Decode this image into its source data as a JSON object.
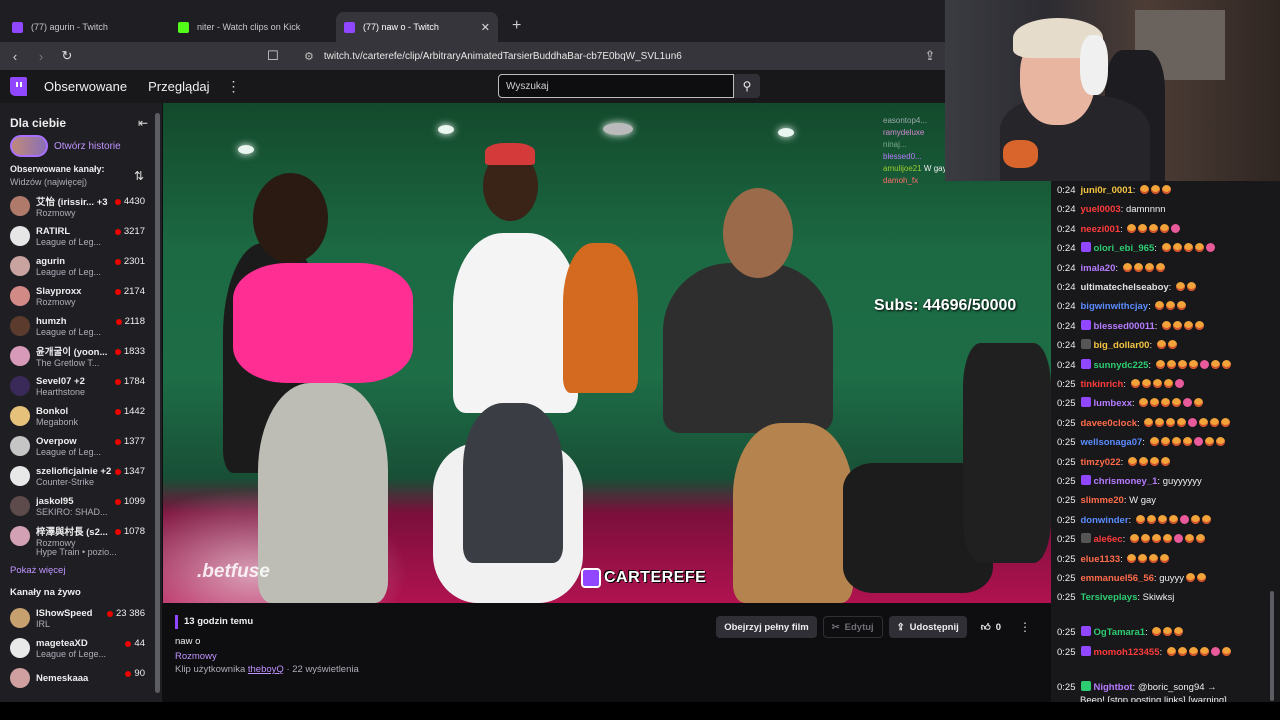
{
  "browser": {
    "tabs": [
      {
        "title": "(77) agurin - Twitch",
        "icon": "twitch-icon",
        "active": false
      },
      {
        "title": "niter - Watch clips on Kick",
        "icon": "kick-icon",
        "active": false
      },
      {
        "title": "(77) naw o - Twitch",
        "icon": "twitch-icon",
        "active": true
      }
    ],
    "url": "twitch.tv/carterefe/clip/ArbitraryAnimatedTarsierBuddhaBar-cb7E0bqW_SVL1un6"
  },
  "topnav": {
    "following": "Obserwowane",
    "browse": "Przeglądaj",
    "search_placeholder": "Wyszukaj"
  },
  "sidebar": {
    "title": "Dla ciebie",
    "stories_label": "Otwórz historie",
    "followed_title": "Obserwowane kanały:",
    "followed_sort": "Widzów (najwięcej)",
    "followed": [
      {
        "name": "艾怡 (irissir... +3",
        "game": "Rozmowy",
        "viewers": "4430",
        "color": "#b07a6a"
      },
      {
        "name": "RATIRL",
        "game": "League of Leg...",
        "viewers": "3217",
        "color": "#e6e6e6"
      },
      {
        "name": "agurin",
        "game": "League of Leg...",
        "viewers": "2301",
        "color": "#c9a3a0"
      },
      {
        "name": "Slayproxx",
        "game": "Rozmowy",
        "viewers": "2174",
        "color": "#d28a86"
      },
      {
        "name": "humzh",
        "game": "League of Leg...",
        "viewers": "2118",
        "color": "#5a3b2d"
      },
      {
        "name": "윤개굴이 (yoon...",
        "game": "The Gretlow T...",
        "viewers": "1833",
        "color": "#d79ab8"
      },
      {
        "name": "Sevel07 +2",
        "game": "Hearthstone",
        "viewers": "1784",
        "color": "#3a2a5a"
      },
      {
        "name": "Bonkol",
        "game": "Megabonk",
        "viewers": "1442",
        "color": "#e6c17a"
      },
      {
        "name": "Overpow",
        "game": "League of Leg...",
        "viewers": "1377",
        "color": "#c5c5c5"
      },
      {
        "name": "szelioficjalnie +2",
        "game": "Counter-Strike",
        "viewers": "1347",
        "color": "#e8e8e8"
      },
      {
        "name": "jaskol95",
        "game": "SEKIRO: SHAD...",
        "viewers": "1099",
        "color": "#5d4a4a"
      },
      {
        "name": "梓澤與村長 (s2...",
        "game": "Rozmowy",
        "viewers": "1078",
        "color": "#d2a2b4"
      }
    ],
    "hype_train": "Hype Train • pozio...",
    "show_more": "Pokaż więcej",
    "live_title": "Kanały na żywo",
    "live": [
      {
        "name": "IShowSpeed",
        "game": "IRL",
        "viewers": "23 386",
        "color": "#c7a070"
      },
      {
        "name": "mageteaXD",
        "game": "League of Lege...",
        "viewers": "44",
        "color": "#e9e9e9"
      },
      {
        "name": "Nemeskaaa",
        "game": "",
        "viewers": "90",
        "color": "#d0a0a0"
      }
    ]
  },
  "video": {
    "subs_text": "Subs: 44696/50000",
    "sponsor": ".betfuse",
    "watermark": "CARTEREFE",
    "overlay_chat": [
      {
        "user": "easontop4...",
        "text": "",
        "color": "#9aa"
      },
      {
        "user": "ramydeluxe",
        "text": "",
        "color": "#d48ad4"
      },
      {
        "user": "ninaj...",
        "text": "",
        "color": "#7a8"
      },
      {
        "user": "blessed0...",
        "text": "",
        "color": "#b77cff"
      },
      {
        "user": "amulijoe21",
        "text": "W gay",
        "color": "#9acd32"
      },
      {
        "user": "damoh_fx",
        "text": "",
        "color": "#ff6b6b"
      }
    ]
  },
  "clip": {
    "time_ago": "13 godzin temu",
    "title": "naw o",
    "category": "Rozmowy",
    "by_prefix": "Klip użytkownika",
    "by_user": "theboyQ",
    "views": "· 22 wyświetlenia",
    "watch_full": "Obejrzyj pełny film",
    "edit": "Edytuj",
    "share": "Udostępnij",
    "likes": "0"
  },
  "chat": {
    "messages": [
      {
        "ts": "0:24",
        "user": "juni0r_0001",
        "color": "#f5c542",
        "text": "",
        "emotes": 3
      },
      {
        "ts": "0:24",
        "user": "yuel0003",
        "color": "#ff3b3b",
        "text": "damnnnn",
        "emotes": 0
      },
      {
        "ts": "0:24",
        "user": "neezi001",
        "color": "#ff3b3b",
        "text": "",
        "emotes": 5
      },
      {
        "ts": "0:24",
        "user": "olori_ebi_965",
        "color": "#2ecc71",
        "text": "",
        "emotes": 5
      },
      {
        "ts": "0:24",
        "user": "imala20",
        "color": "#b77cff",
        "text": "",
        "emotes": 4
      },
      {
        "ts": "0:24",
        "user": "ultimatechelseaboy",
        "color": "#e0e0e0",
        "text": "",
        "emotes": 2
      },
      {
        "ts": "0:24",
        "user": "bigwinwithcjay",
        "color": "#5b8cff",
        "text": "",
        "emotes": 3
      },
      {
        "ts": "0:24",
        "user": "blessed00011",
        "color": "#b77cff",
        "text": "",
        "emotes": 4
      },
      {
        "ts": "0:24",
        "user": "big_dollar00",
        "color": "#f5c542",
        "text": "",
        "emotes": 2
      },
      {
        "ts": "0:24",
        "user": "sunnydc225",
        "color": "#2ecc71",
        "text": "",
        "emotes": 7
      },
      {
        "ts": "0:25",
        "user": "tinkinrich",
        "color": "#ff3b3b",
        "text": "",
        "emotes": 5
      },
      {
        "ts": "0:25",
        "user": "lumbexx",
        "color": "#b77cff",
        "text": "",
        "emotes": 6
      },
      {
        "ts": "0:25",
        "user": "davee0clock",
        "color": "#ff6b4a",
        "text": "",
        "emotes": 8
      },
      {
        "ts": "0:25",
        "user": "wellsonaga07",
        "color": "#5b8cff",
        "text": "",
        "emotes": 7
      },
      {
        "ts": "0:25",
        "user": "timzy022",
        "color": "#ff6b4a",
        "text": "",
        "emotes": 4
      },
      {
        "ts": "0:25",
        "user": "chrismoney_1",
        "color": "#b77cff",
        "text": "guyyyyyy",
        "emotes": 0
      },
      {
        "ts": "0:25",
        "user": "slimme20",
        "color": "#ff6b4a",
        "text": "W gay",
        "emotes": 0
      },
      {
        "ts": "0:25",
        "user": "donwinder",
        "color": "#5b8cff",
        "text": "",
        "emotes": 7
      },
      {
        "ts": "0:25",
        "user": "ale6ec",
        "color": "#ff3b3b",
        "text": "",
        "emotes": 7
      },
      {
        "ts": "0:25",
        "user": "elue1133",
        "color": "#ff6b4a",
        "text": "",
        "emotes": 4
      },
      {
        "ts": "0:25",
        "user": "emmanuel56_56",
        "color": "#ff6b4a",
        "text": "guyyy",
        "emotes": 2
      },
      {
        "ts": "0:25",
        "user": "Tersiveplays",
        "color": "#2ecc71",
        "text": "Skiwksj",
        "emotes": 0
      },
      {
        "ts": "0:25",
        "user": "OgTamara1",
        "color": "#2ecc71",
        "text": "",
        "emotes": 3
      },
      {
        "ts": "0:25",
        "user": "momoh123455",
        "color": "#ff3b3b",
        "text": "",
        "emotes": 6
      },
      {
        "ts": "0:25",
        "user": "Nightbot",
        "color": "#b77cff",
        "text": "@boric_song94 →",
        "emotes": 0
      }
    ],
    "nightbot_line2": "Beep! [stop posting links] [warning]"
  },
  "colors": {
    "accent": "#9146ff",
    "live_dot": "#eb0400"
  }
}
